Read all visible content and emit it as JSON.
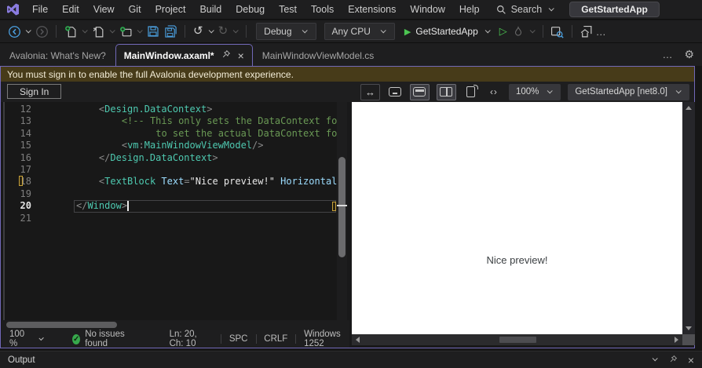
{
  "colors": {
    "accent_purple": "#7168b8",
    "gold_bar_bg": "#473b19",
    "marker_gold": "#c7a13a",
    "run_green": "#4cc552",
    "icon_blue": "#4ba0e0",
    "check_green": "#37a94c"
  },
  "menu_bar": {
    "items": [
      "File",
      "Edit",
      "View",
      "Git",
      "Project",
      "Build",
      "Debug",
      "Test",
      "Tools",
      "Extensions",
      "Window",
      "Help"
    ],
    "search_label": "Search",
    "solution_button": "GetStartedApp"
  },
  "toolbar": {
    "config_dropdown": "Debug",
    "platform_dropdown": "Any CPU",
    "run_button": "GetStartedApp",
    "overflow": "…"
  },
  "tab_bar": {
    "tabs": [
      {
        "label": "Avalonia: What's New?",
        "active": false
      },
      {
        "label": "MainWindow.axaml*",
        "active": true
      },
      {
        "label": "MainWindowViewModel.cs",
        "active": false
      }
    ],
    "overflow": "…"
  },
  "notification": {
    "message": "You must sign in to enable the full Avalonia development experience.",
    "sign_in_label": "Sign In"
  },
  "designer_bar": {
    "swap_glyph": "↔",
    "code_view_glyph": "‹›",
    "zoom_dropdown": "100%",
    "target_dropdown": "GetStartedApp [net8.0]"
  },
  "code_colors": {
    "tag": "#4ec9b0",
    "attr": "#9cdcfe",
    "string": "#e8e8e8",
    "comment": "#6a9955",
    "punct": "#8a8a8a",
    "plain": "#d4d4d4"
  },
  "editor": {
    "current_line": 20,
    "lines": [
      {
        "num": 12,
        "indent": 4,
        "segs": [
          [
            "<",
            "punct"
          ],
          [
            "Design.DataContext",
            "tag"
          ],
          [
            ">",
            "punct"
          ]
        ]
      },
      {
        "num": 13,
        "indent": 8,
        "segs": [
          [
            "<!-- This only sets the DataContext for",
            "comment"
          ]
        ]
      },
      {
        "num": 14,
        "indent": 14,
        "segs": [
          [
            "to set the actual DataContext for r",
            "comment"
          ]
        ]
      },
      {
        "num": 15,
        "indent": 8,
        "segs": [
          [
            "<",
            "punct"
          ],
          [
            "vm",
            "tag"
          ],
          [
            ":",
            "punct"
          ],
          [
            "MainWindowViewModel",
            "tag"
          ],
          [
            "/>",
            "punct"
          ]
        ]
      },
      {
        "num": 16,
        "indent": 4,
        "segs": [
          [
            "</",
            "punct"
          ],
          [
            "Design.DataContext",
            "tag"
          ],
          [
            ">",
            "punct"
          ]
        ]
      },
      {
        "num": 17,
        "indent": 0,
        "segs": []
      },
      {
        "num": 18,
        "indent": 4,
        "segs": [
          [
            "<",
            "punct"
          ],
          [
            "TextBlock",
            "tag"
          ],
          [
            " ",
            "plain"
          ],
          [
            "Text",
            "attr"
          ],
          [
            "=",
            "punct"
          ],
          [
            "\"Nice preview!\"",
            "string"
          ],
          [
            " ",
            "plain"
          ],
          [
            "HorizontalAl",
            "attr"
          ]
        ]
      },
      {
        "num": 19,
        "indent": 0,
        "segs": []
      },
      {
        "num": 20,
        "indent": 0,
        "segs": [
          [
            "</",
            "punct"
          ],
          [
            "Window",
            "tag"
          ],
          [
            ">",
            "punct"
          ]
        ]
      },
      {
        "num": 21,
        "indent": 0,
        "segs": []
      }
    ]
  },
  "preview": {
    "text": "Nice preview!"
  },
  "status_bar": {
    "zoom": "100 %",
    "issues": "No issues found",
    "check_glyph": "✓",
    "caret_position": "Ln: 20, Ch: 10",
    "indent_mode": "SPC",
    "line_ending": "CRLF",
    "encoding": "Windows 1252"
  },
  "output_panel": {
    "title": "Output"
  }
}
